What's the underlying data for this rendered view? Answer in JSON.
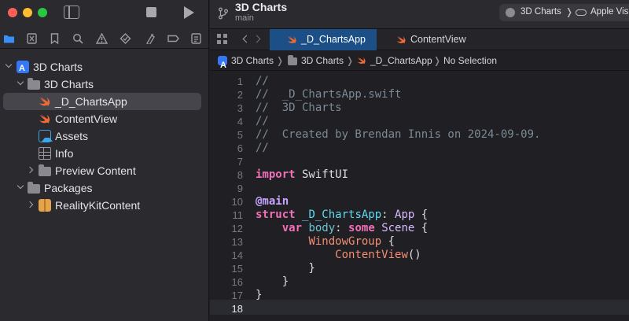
{
  "window": {
    "project_title": "3D Charts",
    "branch": "main",
    "scheme": {
      "name": "3D Charts",
      "separator": "❭",
      "destination": "Apple Vis"
    }
  },
  "sidebar": {
    "nav_icons": [
      "folder-icon",
      "source-control-icon",
      "bookmark-icon",
      "search-icon",
      "warning-icon",
      "test-icon",
      "debug-icon",
      "breakpoint-icon",
      "report-icon"
    ],
    "tree": [
      {
        "label": "3D Charts",
        "kind": "project",
        "indent": 0,
        "expanded": true
      },
      {
        "label": "3D Charts",
        "kind": "folder",
        "indent": 1,
        "expanded": true
      },
      {
        "label": "_D_ChartsApp",
        "kind": "swift",
        "indent": 2,
        "selected": true
      },
      {
        "label": "ContentView",
        "kind": "swift",
        "indent": 2
      },
      {
        "label": "Assets",
        "kind": "assets",
        "indent": 2
      },
      {
        "label": "Info",
        "kind": "plist",
        "indent": 2
      },
      {
        "label": "Preview Content",
        "kind": "folder",
        "indent": 2,
        "expanded": false
      },
      {
        "label": "Packages",
        "kind": "folder",
        "indent": 1,
        "expanded": true
      },
      {
        "label": "RealityKitContent",
        "kind": "package",
        "indent": 2,
        "expanded": false
      }
    ]
  },
  "tabs": [
    {
      "label": "_D_ChartsApp",
      "active": true
    },
    {
      "label": "ContentView",
      "active": false
    }
  ],
  "jumpbar": [
    "3D Charts",
    "3D Charts",
    "_D_ChartsApp",
    "No Selection"
  ],
  "jumpbar_separator": "❭",
  "editor": {
    "current_line": 18,
    "lines": [
      [
        [
          "cmt",
          "//"
        ]
      ],
      [
        [
          "cmt",
          "//  _D_ChartsApp.swift"
        ]
      ],
      [
        [
          "cmt",
          "//  3D Charts"
        ]
      ],
      [
        [
          "cmt",
          "//"
        ]
      ],
      [
        [
          "cmt",
          "//  Created by Brendan Innis on 2024-09-09."
        ]
      ],
      [
        [
          "cmt",
          "//"
        ]
      ],
      [],
      [
        [
          "kw",
          "import"
        ],
        [
          "plain",
          " SwiftUI"
        ]
      ],
      [],
      [
        [
          "attr",
          "@main"
        ]
      ],
      [
        [
          "kw",
          "struct"
        ],
        [
          "plain",
          " "
        ],
        [
          "decl",
          "_D_ChartsApp"
        ],
        [
          "plain",
          ": "
        ],
        [
          "type",
          "App"
        ],
        [
          "plain",
          " {"
        ]
      ],
      [
        [
          "plain",
          "    "
        ],
        [
          "kw",
          "var"
        ],
        [
          "plain",
          " "
        ],
        [
          "prop",
          "body"
        ],
        [
          "plain",
          ": "
        ],
        [
          "kw",
          "some"
        ],
        [
          "plain",
          " "
        ],
        [
          "type",
          "Scene"
        ],
        [
          "plain",
          " {"
        ]
      ],
      [
        [
          "plain",
          "        "
        ],
        [
          "fn",
          "WindowGroup"
        ],
        [
          "plain",
          " {"
        ]
      ],
      [
        [
          "plain",
          "            "
        ],
        [
          "fn",
          "ContentView"
        ],
        [
          "plain",
          "()"
        ]
      ],
      [
        [
          "plain",
          "        }"
        ]
      ],
      [
        [
          "plain",
          "    }"
        ]
      ],
      [
        [
          "plain",
          "}"
        ]
      ],
      []
    ]
  },
  "colors": {
    "sidebar_bg": "#2b2a2f",
    "editor_bg": "#1f1f24",
    "active_tab": "#1b4f86",
    "selection": "#46454c",
    "swift_orange": "#f06a34"
  }
}
